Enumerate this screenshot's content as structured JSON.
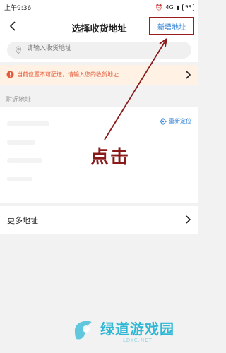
{
  "statusbar": {
    "time": "上午9:36",
    "network": "4G",
    "battery": "98"
  },
  "header": {
    "title": "选择收货地址",
    "new_address": "新增地址",
    "back_icon": "chevron-left-icon"
  },
  "search": {
    "placeholder": "请输入收货地址",
    "icon": "location-pin-icon"
  },
  "warning": {
    "text": "当前位置不可配送，请输入您的收货地址",
    "icon": "warning-icon",
    "color": "#e45b3a"
  },
  "nearby": {
    "section_label": "附近地址",
    "relocate": "重新定位"
  },
  "more": {
    "label": "更多地址"
  },
  "annotation": {
    "text": "点击"
  },
  "watermark": {
    "brand": "绿道游戏园",
    "site": "LDYC.NET"
  },
  "colors": {
    "link": "#2b7fd6",
    "annotation": "#8b1a1a",
    "watermark": "#2fb8d6"
  }
}
